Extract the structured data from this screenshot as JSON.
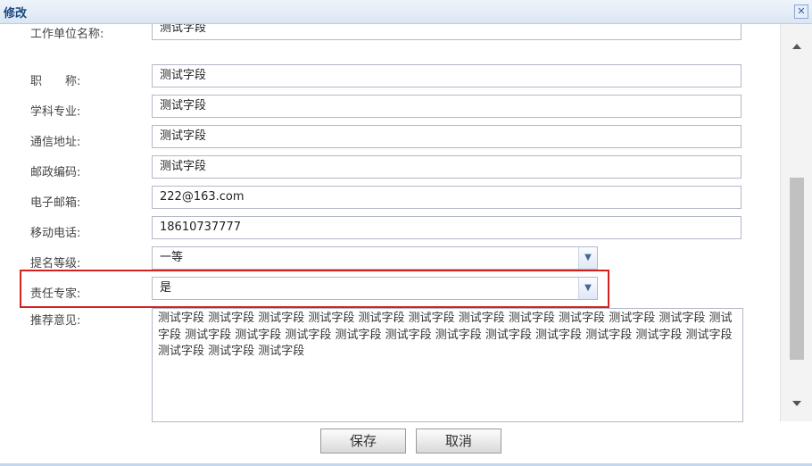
{
  "dialog": {
    "title": "修改",
    "close_label": "✕"
  },
  "form": {
    "fields": [
      {
        "label": "工作单位名称:",
        "value": "测试字段"
      },
      {
        "label": "职　　称:",
        "value": "测试字段"
      },
      {
        "label": "学科专业:",
        "value": "测试字段"
      },
      {
        "label": "通信地址:",
        "value": "测试字段"
      },
      {
        "label": "邮政编码:",
        "value": "测试字段"
      },
      {
        "label": "电子邮箱:",
        "value": "222@163.com"
      },
      {
        "label": "移动电话:",
        "value": "18610737777"
      }
    ],
    "nomination_level": {
      "label": "提名等级:",
      "value": "一等"
    },
    "responsible_expert": {
      "label": "责任专家:",
      "value": "是"
    },
    "recommendation": {
      "label": "推荐意见:",
      "value": "测试字段 测试字段 测试字段 测试字段 测试字段 测试字段 测试字段 测试字段 测试字段 测试字段 测试字段 测试字段 测试字段 测试字段 测试字段 测试字段 测试字段 测试字段 测试字段 测试字段 测试字段 测试字段 测试字段 测试字段 测试字段 测试字段"
    }
  },
  "buttons": {
    "save": "保存",
    "cancel": "取消"
  },
  "colors": {
    "highlight_border": "#d61f1f",
    "title_text": "#1b4a80"
  }
}
